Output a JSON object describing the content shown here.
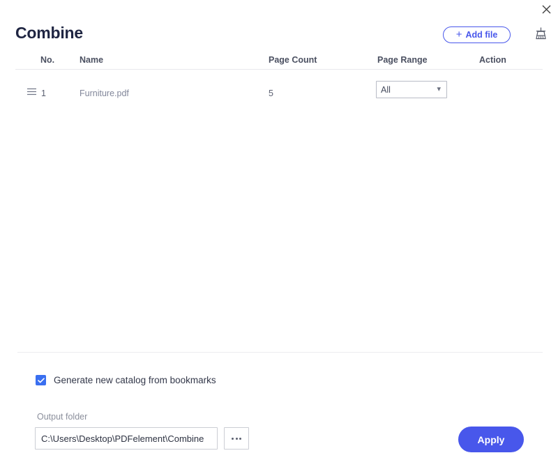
{
  "window": {
    "close_label": "×",
    "close_icon": "close-icon"
  },
  "header": {
    "title": "Combine",
    "add_file_label": "Add file",
    "add_file_plus": "+",
    "clear_icon": "broom-icon"
  },
  "table": {
    "columns": [
      "No.",
      "Name",
      "Page Count",
      "Page Range",
      "Action"
    ],
    "rows": [
      {
        "no": "1",
        "name": "Furniture.pdf",
        "page_count": "5",
        "page_range": "All",
        "drag_icon": "drag-handle-icon"
      }
    ],
    "page_range_options": [
      "All"
    ]
  },
  "options": {
    "catalog_checkbox_label": "Generate new catalog from bookmarks",
    "catalog_checkbox_checked": true
  },
  "output": {
    "label": "Output folder",
    "path": "C:\\Users\\Desktop\\PDFelement\\Combine",
    "placeholder": "C:\\Users\\Desktop\\PDFelement\\Combine",
    "browse_label": "…"
  },
  "actions": {
    "apply_label": "Apply"
  },
  "colors": {
    "accent": "#4857eb",
    "checkbox": "#3a6ff0",
    "title": "#1f2542",
    "muted": "#82879a"
  }
}
